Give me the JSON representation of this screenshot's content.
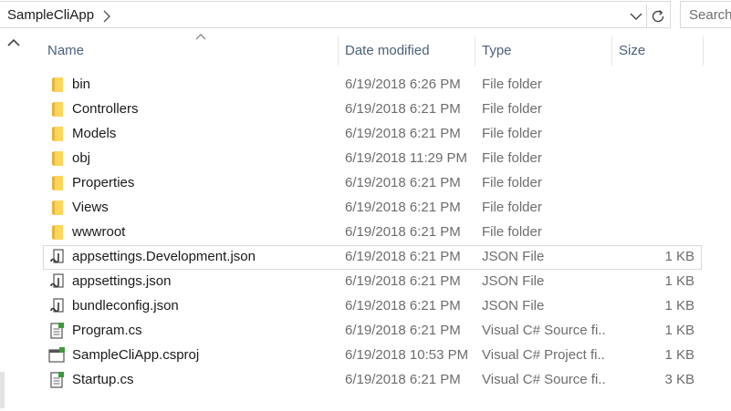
{
  "address": {
    "crumb": "SampleCliApp"
  },
  "search": {
    "placeholder": "Search"
  },
  "columns": {
    "name": "Name",
    "date": "Date modified",
    "type": "Type",
    "size": "Size"
  },
  "colors": {
    "folder": "#ffd55a",
    "folder_dark": "#e8b33c",
    "header_text": "#4c607a"
  },
  "files": [
    {
      "name": "bin",
      "date": "6/19/2018 6:26 PM",
      "type": "File folder",
      "size": "",
      "icon": "folder-icon"
    },
    {
      "name": "Controllers",
      "date": "6/19/2018 6:21 PM",
      "type": "File folder",
      "size": "",
      "icon": "folder-icon"
    },
    {
      "name": "Models",
      "date": "6/19/2018 6:21 PM",
      "type": "File folder",
      "size": "",
      "icon": "folder-icon"
    },
    {
      "name": "obj",
      "date": "6/19/2018 11:29 PM",
      "type": "File folder",
      "size": "",
      "icon": "folder-icon"
    },
    {
      "name": "Properties",
      "date": "6/19/2018 6:21 PM",
      "type": "File folder",
      "size": "",
      "icon": "folder-icon"
    },
    {
      "name": "Views",
      "date": "6/19/2018 6:21 PM",
      "type": "File folder",
      "size": "",
      "icon": "folder-icon"
    },
    {
      "name": "wwwroot",
      "date": "6/19/2018 6:21 PM",
      "type": "File folder",
      "size": "",
      "icon": "folder-icon"
    },
    {
      "name": "appsettings.Development.json",
      "date": "6/19/2018 6:21 PM",
      "type": "JSON File",
      "size": "1 KB",
      "icon": "json-file-icon"
    },
    {
      "name": "appsettings.json",
      "date": "6/19/2018 6:21 PM",
      "type": "JSON File",
      "size": "1 KB",
      "icon": "json-file-icon"
    },
    {
      "name": "bundleconfig.json",
      "date": "6/19/2018 6:21 PM",
      "type": "JSON File",
      "size": "1 KB",
      "icon": "json-file-icon"
    },
    {
      "name": "Program.cs",
      "date": "6/19/2018 6:21 PM",
      "type": "Visual C# Source fi...",
      "size": "1 KB",
      "icon": "csharp-file-icon"
    },
    {
      "name": "SampleCliApp.csproj",
      "date": "6/19/2018 10:53 PM",
      "type": "Visual C# Project fi...",
      "size": "1 KB",
      "icon": "csproj-file-icon"
    },
    {
      "name": "Startup.cs",
      "date": "6/19/2018 6:21 PM",
      "type": "Visual C# Source fi...",
      "size": "3 KB",
      "icon": "csharp-file-icon"
    }
  ]
}
